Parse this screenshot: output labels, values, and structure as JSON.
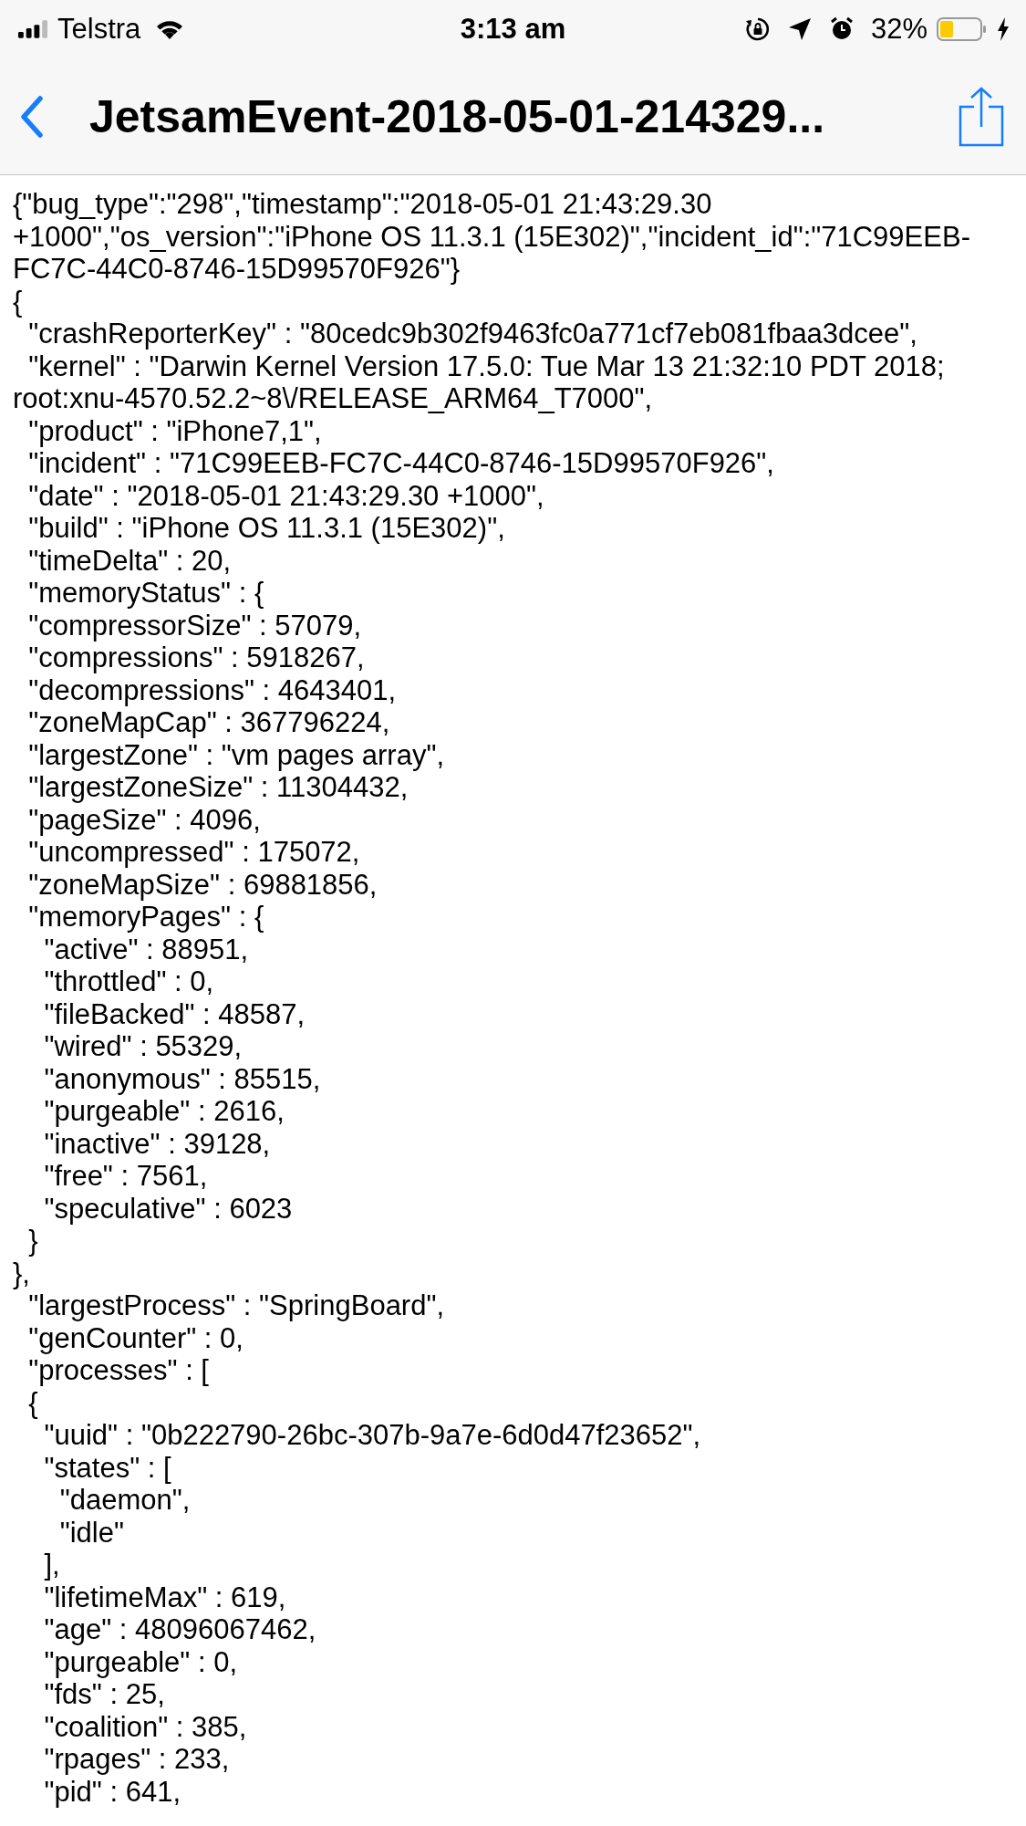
{
  "status_bar": {
    "carrier": "Telstra",
    "time": "3:13 am",
    "battery": "32%"
  },
  "nav": {
    "title": "JetsamEvent-2018-05-01-214329..."
  },
  "lines": [
    "{\"bug_type\":\"298\",\"timestamp\":\"2018-05-01 21:43:29.30",
    "+1000\",\"os_version\":\"iPhone OS 11.3.1 (15E302)\",\"incident_id\":\"71C99EEB-",
    "FC7C-44C0-8746-15D99570F926\"}",
    "{",
    "  \"crashReporterKey\" : \"80cedc9b302f9463fc0a771cf7eb081fbaa3dcee\",",
    "  \"kernel\" : \"Darwin Kernel Version 17.5.0: Tue Mar 13 21:32:10 PDT 2018;",
    "root:xnu-4570.52.2~8\\/RELEASE_ARM64_T7000\",",
    "  \"product\" : \"iPhone7,1\",",
    "  \"incident\" : \"71C99EEB-FC7C-44C0-8746-15D99570F926\",",
    "  \"date\" : \"2018-05-01 21:43:29.30 +1000\",",
    "  \"build\" : \"iPhone OS 11.3.1 (15E302)\",",
    "  \"timeDelta\" : 20,",
    "  \"memoryStatus\" : {",
    "  \"compressorSize\" : 57079,",
    "  \"compressions\" : 5918267,",
    "  \"decompressions\" : 4643401,",
    "  \"zoneMapCap\" : 367796224,",
    "  \"largestZone\" : \"vm pages array\",",
    "  \"largestZoneSize\" : 11304432,",
    "  \"pageSize\" : 4096,",
    "  \"uncompressed\" : 175072,",
    "  \"zoneMapSize\" : 69881856,",
    "  \"memoryPages\" : {",
    "    \"active\" : 88951,",
    "    \"throttled\" : 0,",
    "    \"fileBacked\" : 48587,",
    "    \"wired\" : 55329,",
    "    \"anonymous\" : 85515,",
    "    \"purgeable\" : 2616,",
    "    \"inactive\" : 39128,",
    "    \"free\" : 7561,",
    "    \"speculative\" : 6023",
    "  }",
    "},",
    "  \"largestProcess\" : \"SpringBoard\",",
    "  \"genCounter\" : 0,",
    "  \"processes\" : [",
    "  {",
    "    \"uuid\" : \"0b222790-26bc-307b-9a7e-6d0d47f23652\",",
    "    \"states\" : [",
    "      \"daemon\",",
    "      \"idle\"",
    "    ],",
    "    \"lifetimeMax\" : 619,",
    "    \"age\" : 48096067462,",
    "    \"purgeable\" : 0,",
    "    \"fds\" : 25,",
    "    \"coalition\" : 385,",
    "    \"rpages\" : 233,",
    "    \"pid\" : 641,"
  ]
}
